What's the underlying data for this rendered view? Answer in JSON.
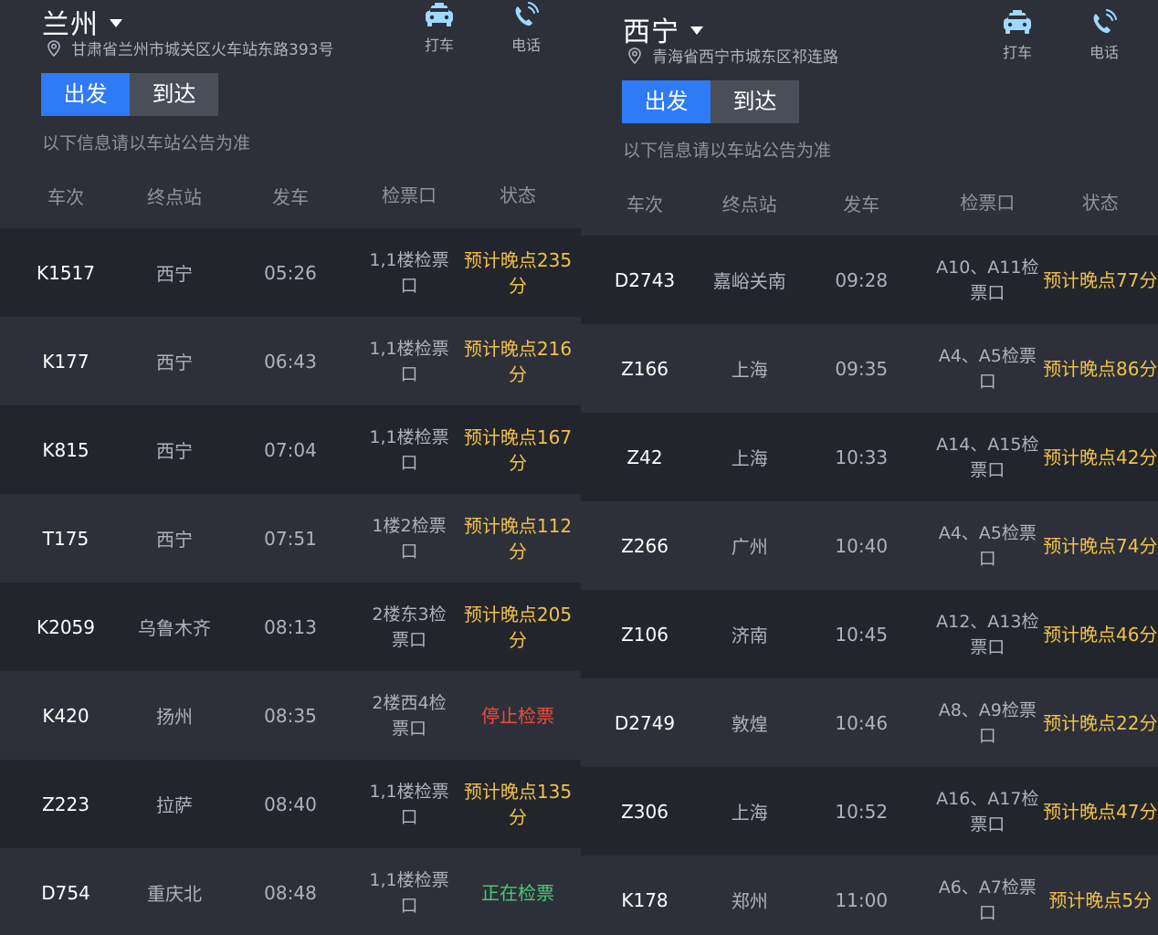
{
  "left": {
    "city": "兰州",
    "address": "甘肃省兰州市城关区火车站东路393号",
    "taxi_label": "打车",
    "phone_label": "电话",
    "tab_depart": "出发",
    "tab_arrive": "到达",
    "notice": "以下信息请以车站公告为准",
    "columns": [
      "车次",
      "终点站",
      "发车",
      "检票口",
      "状态"
    ],
    "rows": [
      {
        "train": "K1517",
        "dest": "西宁",
        "time": "05:26",
        "gate": "1,1楼检票口",
        "status": "预计晚点235分",
        "status_type": "late"
      },
      {
        "train": "K177",
        "dest": "西宁",
        "time": "06:43",
        "gate": "1,1楼检票口",
        "status": "预计晚点216分",
        "status_type": "late"
      },
      {
        "train": "K815",
        "dest": "西宁",
        "time": "07:04",
        "gate": "1,1楼检票口",
        "status": "预计晚点167分",
        "status_type": "late"
      },
      {
        "train": "T175",
        "dest": "西宁",
        "time": "07:51",
        "gate": "1楼2检票口",
        "status": "预计晚点112分",
        "status_type": "late"
      },
      {
        "train": "K2059",
        "dest": "乌鲁木齐",
        "time": "08:13",
        "gate": "2楼东3检票口",
        "status": "预计晚点205分",
        "status_type": "late"
      },
      {
        "train": "K420",
        "dest": "扬州",
        "time": "08:35",
        "gate": "2楼西4检票口",
        "status": "停止检票",
        "status_type": "stop"
      },
      {
        "train": "Z223",
        "dest": "拉萨",
        "time": "08:40",
        "gate": "1,1楼检票口",
        "status": "预计晚点135分",
        "status_type": "late"
      },
      {
        "train": "D754",
        "dest": "重庆北",
        "time": "08:48",
        "gate": "1,1楼检票口",
        "status": "正在检票",
        "status_type": "go"
      }
    ]
  },
  "right": {
    "city": "西宁",
    "address": "青海省西宁市城东区祁连路",
    "taxi_label": "打车",
    "phone_label": "电话",
    "tab_depart": "出发",
    "tab_arrive": "到达",
    "notice": "以下信息请以车站公告为准",
    "columns": [
      "车次",
      "终点站",
      "发车",
      "检票口",
      "状态"
    ],
    "rows": [
      {
        "train": "D2743",
        "dest": "嘉峪关南",
        "time": "09:28",
        "gate": "A10、A11检票口",
        "status": "预计晚点77分",
        "status_type": "late"
      },
      {
        "train": "Z166",
        "dest": "上海",
        "time": "09:35",
        "gate": "A4、A5检票口",
        "status": "预计晚点86分",
        "status_type": "late"
      },
      {
        "train": "Z42",
        "dest": "上海",
        "time": "10:33",
        "gate": "A14、A15检票口",
        "status": "预计晚点42分",
        "status_type": "late"
      },
      {
        "train": "Z266",
        "dest": "广州",
        "time": "10:40",
        "gate": "A4、A5检票口",
        "status": "预计晚点74分",
        "status_type": "late"
      },
      {
        "train": "Z106",
        "dest": "济南",
        "time": "10:45",
        "gate": "A12、A13检票口",
        "status": "预计晚点46分",
        "status_type": "late"
      },
      {
        "train": "D2749",
        "dest": "敦煌",
        "time": "10:46",
        "gate": "A8、A9检票口",
        "status": "预计晚点22分",
        "status_type": "late"
      },
      {
        "train": "Z306",
        "dest": "上海",
        "time": "10:52",
        "gate": "A16、A17检票口",
        "status": "预计晚点47分",
        "status_type": "late"
      },
      {
        "train": "K178",
        "dest": "郑州",
        "time": "11:00",
        "gate": "A6、A7检票口",
        "status": "预计晚点5分",
        "status_type": "late"
      }
    ]
  },
  "colors": {
    "accent": "#2f7af5",
    "late": "#f2c14a",
    "stop": "#ef4b3c",
    "go": "#48c977"
  },
  "icons": {
    "location": "location-pin-icon",
    "taxi": "taxi-icon",
    "phone": "phone-icon",
    "dropdown": "caret-down-icon"
  }
}
